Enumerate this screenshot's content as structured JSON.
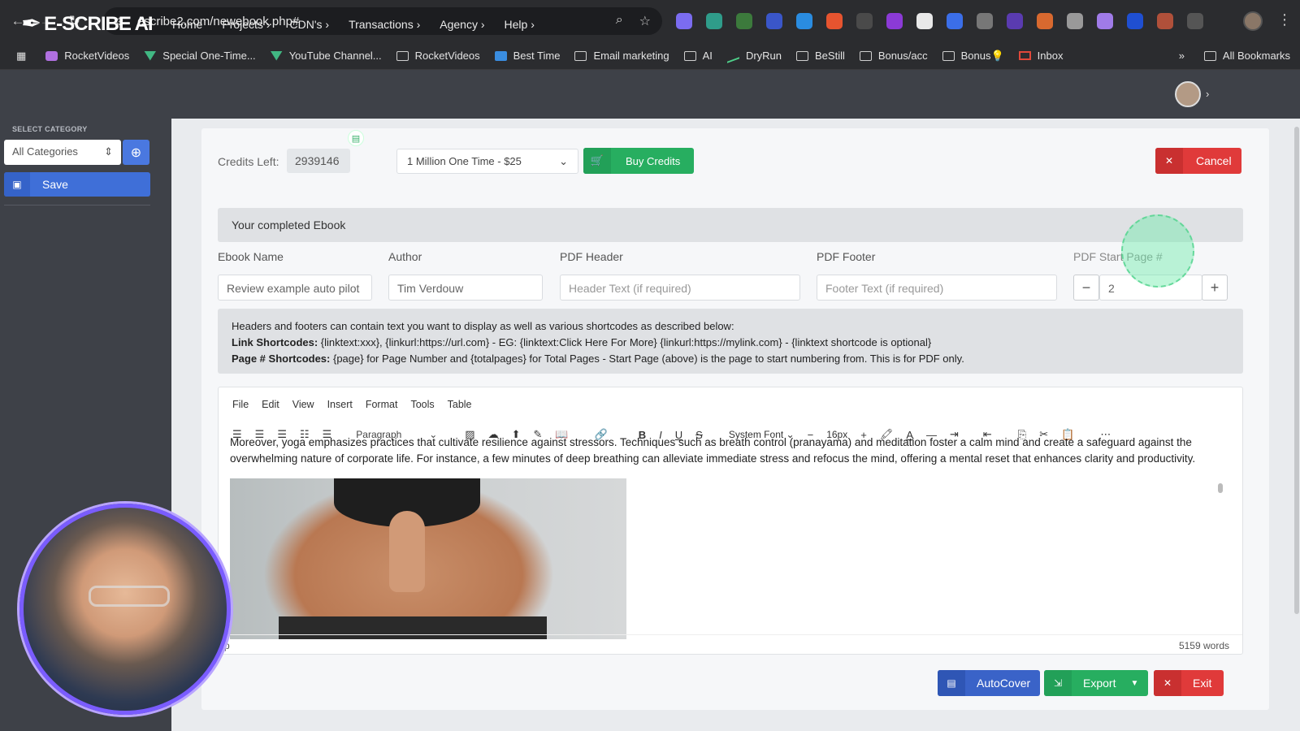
{
  "browser": {
    "url": "escribe2.com/newebook.php#",
    "bookmarks": [
      {
        "label": "RocketVideos",
        "icon": "rocket-icon"
      },
      {
        "label": "Special One-Time...",
        "icon": "vue-icon"
      },
      {
        "label": "YouTube Channel...",
        "icon": "vue-icon"
      },
      {
        "label": "RocketVideos",
        "icon": "folder-icon"
      },
      {
        "label": "Best Time",
        "icon": "mail-icon"
      },
      {
        "label": "Email marketing",
        "icon": "folder-icon"
      },
      {
        "label": "AI",
        "icon": "folder-icon"
      },
      {
        "label": "DryRun",
        "icon": "chart-icon"
      },
      {
        "label": "BeStill",
        "icon": "folder-icon"
      },
      {
        "label": "Bonus/acc",
        "icon": "folder-icon"
      },
      {
        "label": "Bonus💡",
        "icon": "folder-icon"
      },
      {
        "label": "Inbox",
        "icon": "gmail-icon"
      }
    ],
    "all_bookmarks": "All Bookmarks",
    "overflow": "»"
  },
  "app": {
    "logo": "E-SCRIBE AI",
    "menu": [
      "Home",
      "Projects",
      "CDN's",
      "Transactions",
      "Agency",
      "Help"
    ]
  },
  "sidebar": {
    "heading": "SELECT CATEGORY",
    "category": "All Categories",
    "save_label": "Save"
  },
  "credits": {
    "label": "Credits Left:",
    "value": "2939146",
    "plan": "1 Million One Time - $25",
    "buy_label": "Buy Credits",
    "cancel_label": "Cancel"
  },
  "ebook": {
    "banner": "Your completed Ebook",
    "fields": {
      "name_label": "Ebook Name",
      "name_value": "Review example auto pilot",
      "author_label": "Author",
      "author_value": "Tim Verdouw",
      "header_label": "PDF Header",
      "header_placeholder": "Header Text (if required)",
      "footer_label": "PDF Footer",
      "footer_placeholder": "Footer Text (if required)",
      "start_label": "PDF Start Page #",
      "start_value": "2"
    },
    "info": {
      "line1": "Headers and footers can contain text you want to display as well as various shortcodes as described below:",
      "line2_bold": "Link Shortcodes:",
      "line2": " {linktext:xxx}, {linkurl:https://url.com} - EG: {linktext:Click Here For More} {linkurl:https://mylink.com} - {linktext shortcode is optional}",
      "line3_bold": "Page # Shortcodes:",
      "line3": " {page} for Page Number and {totalpages} for Total Pages - Start Page (above) is the page to start numbering from. This is for PDF only."
    }
  },
  "editor": {
    "menu": [
      "File",
      "Edit",
      "View",
      "Insert",
      "Format",
      "Tools",
      "Table"
    ],
    "block": "Paragraph",
    "font": "System Font",
    "size": "16px",
    "text1": "Moreover, yoga emphasizes practices that cultivate resilience against stressors. Techniques such as breath control (pranayama) and meditation foster a calm mind and create a safeguard against the",
    "text2": "overwhelming nature of corporate life. For instance, a few minutes of deep breathing can alleviate immediate stress and refocus the mind, offering a mental reset that enhances clarity and productivity.",
    "path": "p",
    "words": "5159 words"
  },
  "actions": {
    "autocover": "AutoCover",
    "export": "Export",
    "exit": "Exit"
  },
  "colors": {
    "green": "#27ae60",
    "red": "#e03a3a",
    "blue": "#3f6fd8"
  }
}
